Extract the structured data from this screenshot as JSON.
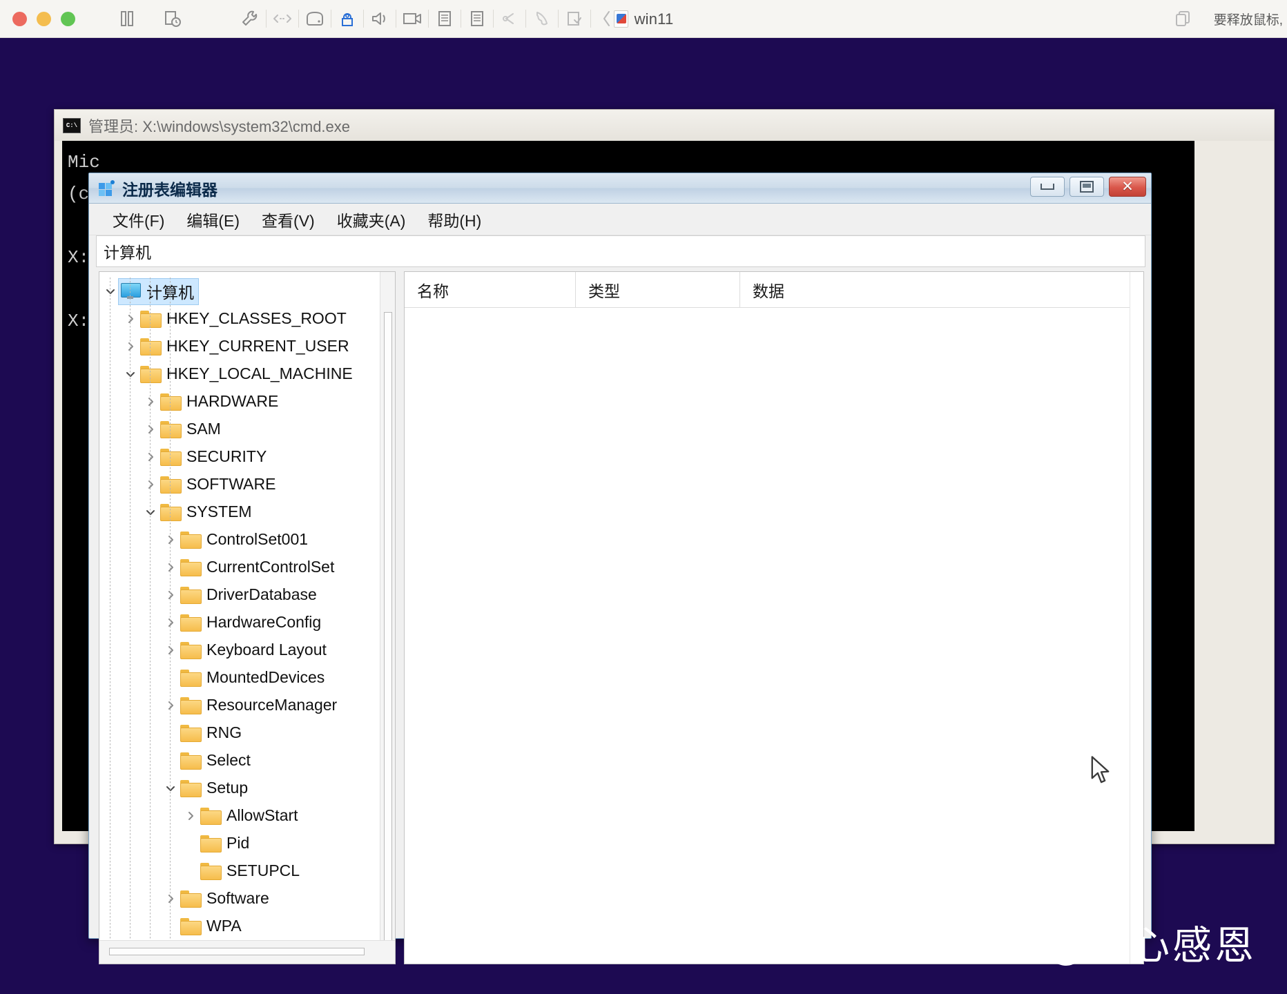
{
  "host": {
    "traffic_lights": [
      "close",
      "minimize",
      "zoom"
    ],
    "toolbar_icons": [
      {
        "name": "pause-icon",
        "glyph": "pause"
      },
      {
        "name": "snapshot-icon",
        "glyph": "snapshot"
      },
      {
        "name": "settings-wrench-icon",
        "glyph": "wrench"
      },
      {
        "name": "network-icon",
        "glyph": "network"
      },
      {
        "name": "harddisk-icon",
        "glyph": "harddisk"
      },
      {
        "name": "usb-icon",
        "glyph": "usb"
      },
      {
        "name": "sound-icon",
        "glyph": "sound"
      },
      {
        "name": "camera-icon",
        "glyph": "camera"
      },
      {
        "name": "printer-icon",
        "glyph": "printer"
      },
      {
        "name": "printer2-icon",
        "glyph": "printer"
      },
      {
        "name": "share-icon",
        "glyph": "share"
      },
      {
        "name": "bluetooth-phone-icon",
        "glyph": "phone"
      },
      {
        "name": "clipboard-icon",
        "glyph": "clipboard"
      },
      {
        "name": "back-chevron-icon",
        "glyph": "chevron-left"
      }
    ],
    "title": "win11",
    "right_hint": "要释放鼠标,",
    "fullscreen_icon": "window-restore-icon"
  },
  "cmd_window": {
    "title": "管理员: X:\\windows\\system32\\cmd.exe",
    "icon_label": "C:\\",
    "lines": [
      "Mic",
      "(c)",
      "",
      "X:\\",
      "",
      "X:\\"
    ]
  },
  "regedit": {
    "title": "注册表编辑器",
    "window_buttons": {
      "minimize": "最小化",
      "maximize": "最大化",
      "close": "关闭"
    },
    "menu": [
      "文件(F)",
      "编辑(E)",
      "查看(V)",
      "收藏夹(A)",
      "帮助(H)"
    ],
    "address": "计算机",
    "tree": [
      {
        "label": "计算机",
        "depth": 0,
        "twisty": "down",
        "icon": "computer",
        "selected": true
      },
      {
        "label": "HKEY_CLASSES_ROOT",
        "depth": 1,
        "twisty": "right",
        "icon": "folder",
        "selected": false
      },
      {
        "label": "HKEY_CURRENT_USER",
        "depth": 1,
        "twisty": "right",
        "icon": "folder",
        "selected": false
      },
      {
        "label": "HKEY_LOCAL_MACHINE",
        "depth": 1,
        "twisty": "down",
        "icon": "folder",
        "selected": false
      },
      {
        "label": "HARDWARE",
        "depth": 2,
        "twisty": "right",
        "icon": "folder",
        "selected": false
      },
      {
        "label": "SAM",
        "depth": 2,
        "twisty": "right",
        "icon": "folder",
        "selected": false
      },
      {
        "label": "SECURITY",
        "depth": 2,
        "twisty": "right",
        "icon": "folder",
        "selected": false
      },
      {
        "label": "SOFTWARE",
        "depth": 2,
        "twisty": "right",
        "icon": "folder",
        "selected": false
      },
      {
        "label": "SYSTEM",
        "depth": 2,
        "twisty": "down",
        "icon": "folder",
        "selected": false
      },
      {
        "label": "ControlSet001",
        "depth": 3,
        "twisty": "right",
        "icon": "folder",
        "selected": false
      },
      {
        "label": "CurrentControlSet",
        "depth": 3,
        "twisty": "right",
        "icon": "folder",
        "selected": false
      },
      {
        "label": "DriverDatabase",
        "depth": 3,
        "twisty": "right",
        "icon": "folder",
        "selected": false
      },
      {
        "label": "HardwareConfig",
        "depth": 3,
        "twisty": "right",
        "icon": "folder",
        "selected": false
      },
      {
        "label": "Keyboard Layout",
        "depth": 3,
        "twisty": "right",
        "icon": "folder",
        "selected": false
      },
      {
        "label": "MountedDevices",
        "depth": 3,
        "twisty": "none",
        "icon": "folder",
        "selected": false
      },
      {
        "label": "ResourceManager",
        "depth": 3,
        "twisty": "right",
        "icon": "folder",
        "selected": false
      },
      {
        "label": "RNG",
        "depth": 3,
        "twisty": "none",
        "icon": "folder",
        "selected": false
      },
      {
        "label": "Select",
        "depth": 3,
        "twisty": "none",
        "icon": "folder",
        "selected": false
      },
      {
        "label": "Setup",
        "depth": 3,
        "twisty": "down",
        "icon": "folder",
        "selected": false
      },
      {
        "label": "AllowStart",
        "depth": 4,
        "twisty": "right",
        "icon": "folder",
        "selected": false
      },
      {
        "label": "Pid",
        "depth": 4,
        "twisty": "none",
        "icon": "folder",
        "selected": false
      },
      {
        "label": "SETUPCL",
        "depth": 4,
        "twisty": "none",
        "icon": "folder",
        "selected": false
      },
      {
        "label": "Software",
        "depth": 3,
        "twisty": "right",
        "icon": "folder",
        "selected": false
      },
      {
        "label": "WPA",
        "depth": 3,
        "twisty": "none",
        "icon": "folder",
        "selected": false
      }
    ],
    "columns": [
      "名称",
      "类型",
      "数据"
    ],
    "rows": []
  },
  "watermark": "知乎 @开心感恩",
  "colors": {
    "desktop": "#1d0a52",
    "host_toolbar": "#f6f5f2",
    "selection": "#cde8ff",
    "folder": "#f6bd4c",
    "close_button": "#d9564a"
  }
}
